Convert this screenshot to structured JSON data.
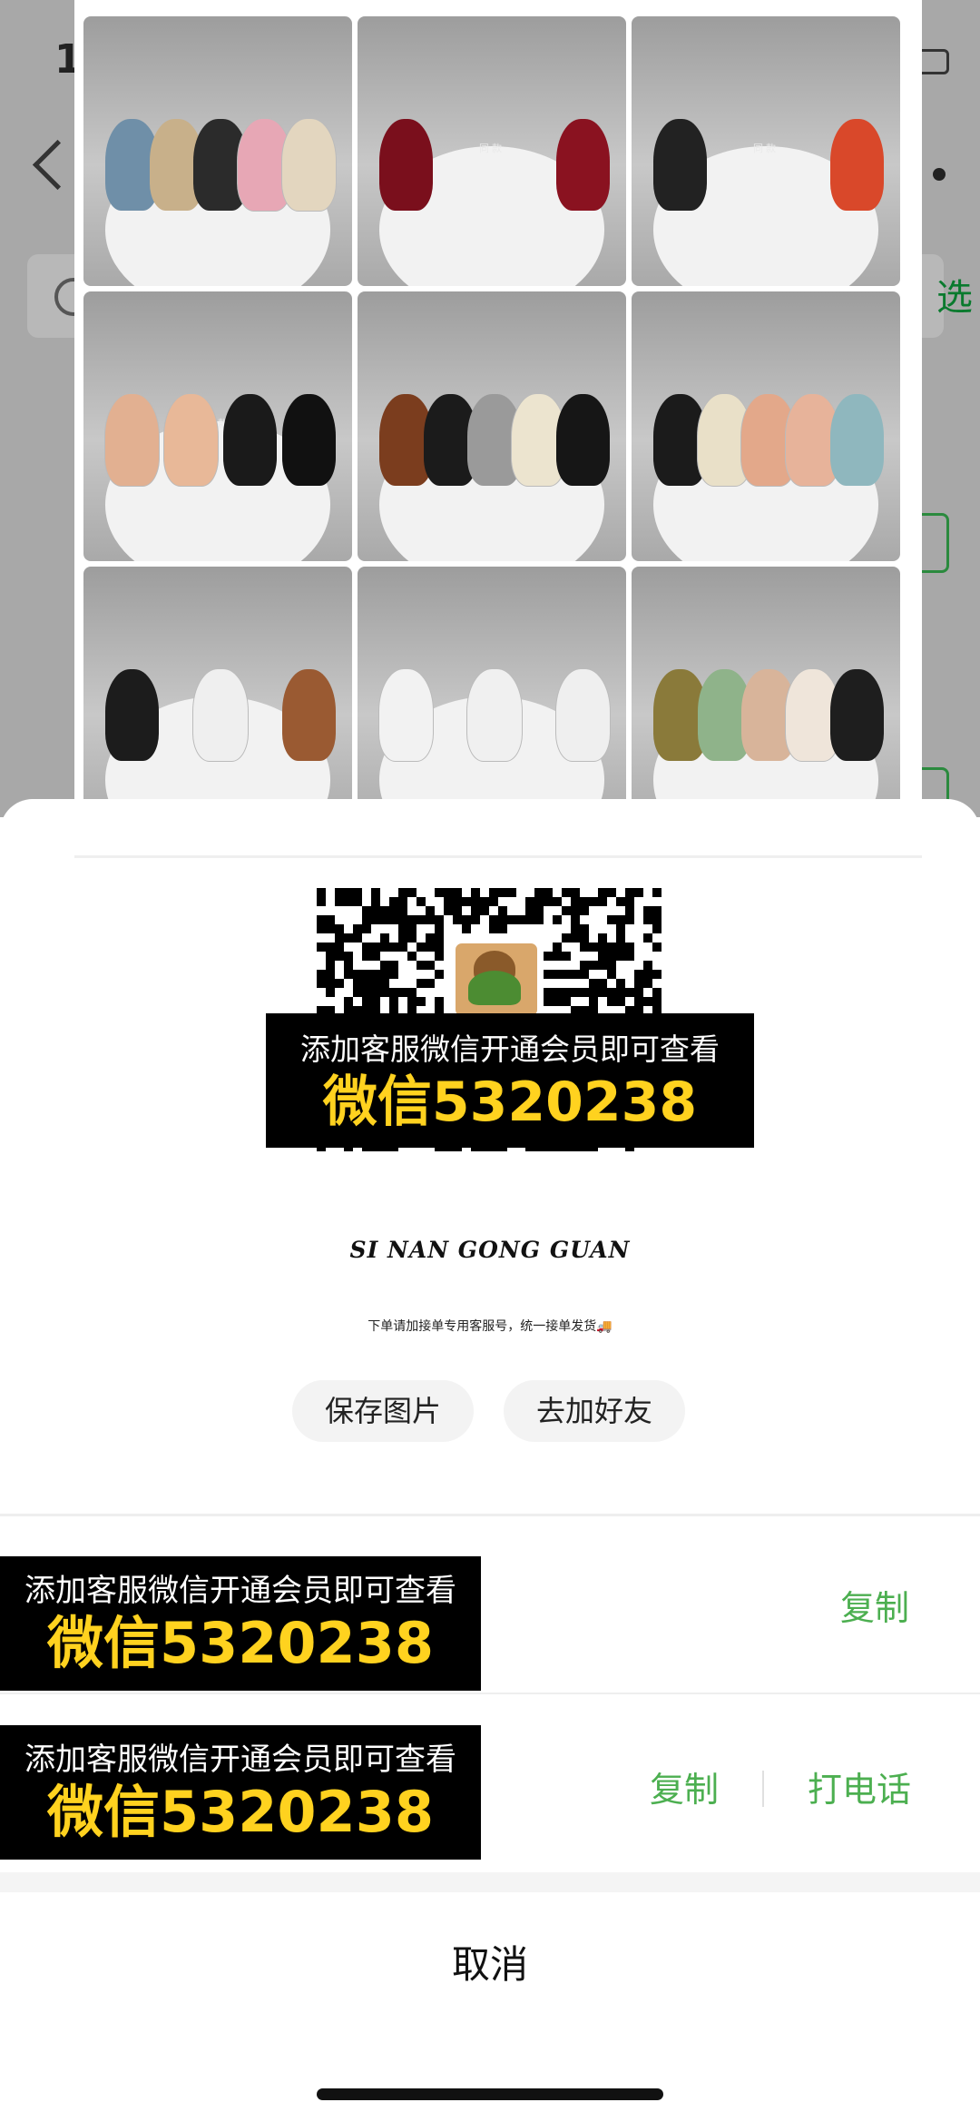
{
  "background": {
    "time": "1",
    "filter_label": "选"
  },
  "poster": {
    "photos": [
      {
        "name": "photo-woven-sandals",
        "shoes": [
          "#6f8fa8",
          "#c8b08a",
          "#2b2b2b",
          "#e7a7b5",
          "#e3d6bf"
        ]
      },
      {
        "name": "photo-red-slingback",
        "shoes": [
          "#7a0f1c",
          "#8a1220"
        ]
      },
      {
        "name": "photo-thong-sandals",
        "shoes": [
          "#222222",
          "#d9482a"
        ]
      },
      {
        "name": "photo-nude-black-pumps",
        "shoes": [
          "#e2b091",
          "#e8b898",
          "#1a1a1a",
          "#111111"
        ]
      },
      {
        "name": "photo-square-toe-loafers",
        "shoes": [
          "#7b3d1e",
          "#1b1b1b",
          "#9a9a9a",
          "#ece4cf",
          "#161616"
        ]
      },
      {
        "name": "photo-ballet-flats",
        "shoes": [
          "#1b1b1b",
          "#e9e0c8",
          "#e3a88a",
          "#e7b39a",
          "#8fb7be"
        ]
      },
      {
        "name": "photo-platform-sandals",
        "shoes": [
          "#1c1c1c",
          "#efefef",
          "#9a5a32"
        ]
      },
      {
        "name": "photo-white-sneakers",
        "shoes": [
          "#f2f2f2",
          "#f0f0f0",
          "#efefef"
        ]
      },
      {
        "name": "photo-woven-mules",
        "shoes": [
          "#8a7a3a",
          "#8fb38a",
          "#d8b49a",
          "#efe5da",
          "#1e1e1e"
        ]
      }
    ],
    "watermark": "同款",
    "promo": {
      "line1": "添加客服微信开通会员即可查看",
      "line2": "微信5320238"
    },
    "brand": "SI NAN GONG GUAN",
    "notice": "下单请加接单专用客服号，统一接单发货🚚"
  },
  "actions": {
    "save_image": "保存图片",
    "add_friend": "去加好友"
  },
  "rows": [
    {
      "promo_line1": "添加客服微信开通会员即可查看",
      "promo_line2": "微信5320238",
      "copy": "复制"
    },
    {
      "promo_line1": "添加客服微信开通会员即可查看",
      "promo_line2": "微信5320238",
      "copy": "复制",
      "call": "打电话"
    }
  ],
  "cancel": "取消",
  "colors": {
    "accent_green": "#4caf50",
    "promo_yellow": "#ffd21f",
    "promo_background": "#000000"
  }
}
